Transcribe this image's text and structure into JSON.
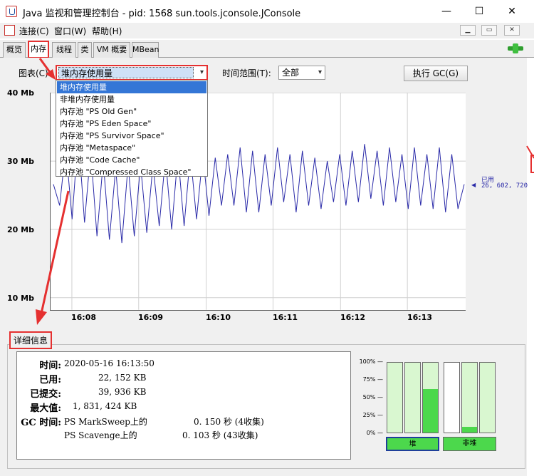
{
  "window": {
    "title": "Java 监视和管理控制台 - pid: 1568 sun.tools.jconsole.JConsole",
    "minimize": "—",
    "maximize": "☐",
    "close": "✕"
  },
  "menubar": {
    "items": [
      "连接(C)",
      "窗口(W)",
      "帮助(H)"
    ],
    "mdi_buttons": [
      "▁",
      "▭",
      "✕"
    ]
  },
  "tabs": [
    "概览",
    "内存",
    "线程",
    "类",
    "VM 概要",
    "MBean"
  ],
  "controls": {
    "chart_label": "图表(C):",
    "chart_value": "堆内存使用量",
    "time_range_label": "时间范围(T):",
    "time_range_value": "全部",
    "gc_button": "执行 GC(G)"
  },
  "dropdown_options": [
    "堆内存使用量",
    "非堆内存使用量",
    "内存池 \"PS Old Gen\"",
    "内存池 \"PS Eden Space\"",
    "内存池 \"PS Survivor Space\"",
    "内存池 \"Metaspace\"",
    "内存池 \"Code Cache\"",
    "内存池 \"Compressed Class Space\""
  ],
  "chart_data": {
    "type": "line",
    "title": "",
    "ylabel": "",
    "xlabel": "",
    "y_ticks": [
      "40 Mb",
      "30 Mb",
      "20 Mb",
      "10 Mb"
    ],
    "x_ticks": [
      "16:08",
      "16:09",
      "16:10",
      "16:11",
      "16:12",
      "16:13"
    ],
    "ylim": [
      10,
      40
    ],
    "series": [
      {
        "name": "已用",
        "color": "#2a2aa8",
        "values": [
          26.6,
          23.5,
          32,
          21.5,
          34,
          21,
          31.5,
          19,
          30,
          18.5,
          29,
          18,
          29.5,
          19,
          29.5,
          19.5,
          29.5,
          20.5,
          30.5,
          20,
          31,
          20.5,
          31,
          21.5,
          31,
          22,
          30.5,
          23.5,
          31,
          23.5,
          32,
          22.5,
          31.5,
          22.5,
          31,
          23.5,
          32,
          24,
          31,
          22.5,
          31.5,
          23.5,
          30.5,
          23,
          30,
          24,
          31,
          23.5,
          31.5,
          24,
          32.5,
          24.5,
          31.5,
          23.5,
          32,
          24,
          31,
          23,
          32,
          23.5,
          31,
          23,
          32,
          22.5,
          31,
          23,
          26.6
        ]
      }
    ],
    "current_label": "已用",
    "current_value": "26, 602, 720"
  },
  "details": {
    "section_title": "详细信息",
    "time_label": "时间:",
    "time_value": "2020-05-16 16:13:50",
    "used_label": "已用:",
    "used_value": "22, 152 KB",
    "committed_label": "已提交:",
    "committed_value": "39, 936 KB",
    "max_label": "最大值:",
    "max_value": "1, 831, 424 KB",
    "gc_label": "GC 时间:",
    "gc_rows": [
      {
        "name": "PS MarkSweep上的",
        "value": "0. 150 秒 (4收集)"
      },
      {
        "name": "PS Scavenge上的",
        "value": "0. 103 秒 (43收集)"
      }
    ]
  },
  "pool_bars": {
    "pct_labels": [
      "100% —",
      "75% —",
      "50% —",
      "25% —",
      "0% —"
    ],
    "heap_label": "堆",
    "nonheap_label": "非堆",
    "heap_fills": [
      0,
      0,
      0.62
    ],
    "nonheap_fills": [
      0,
      0.08,
      0
    ]
  }
}
